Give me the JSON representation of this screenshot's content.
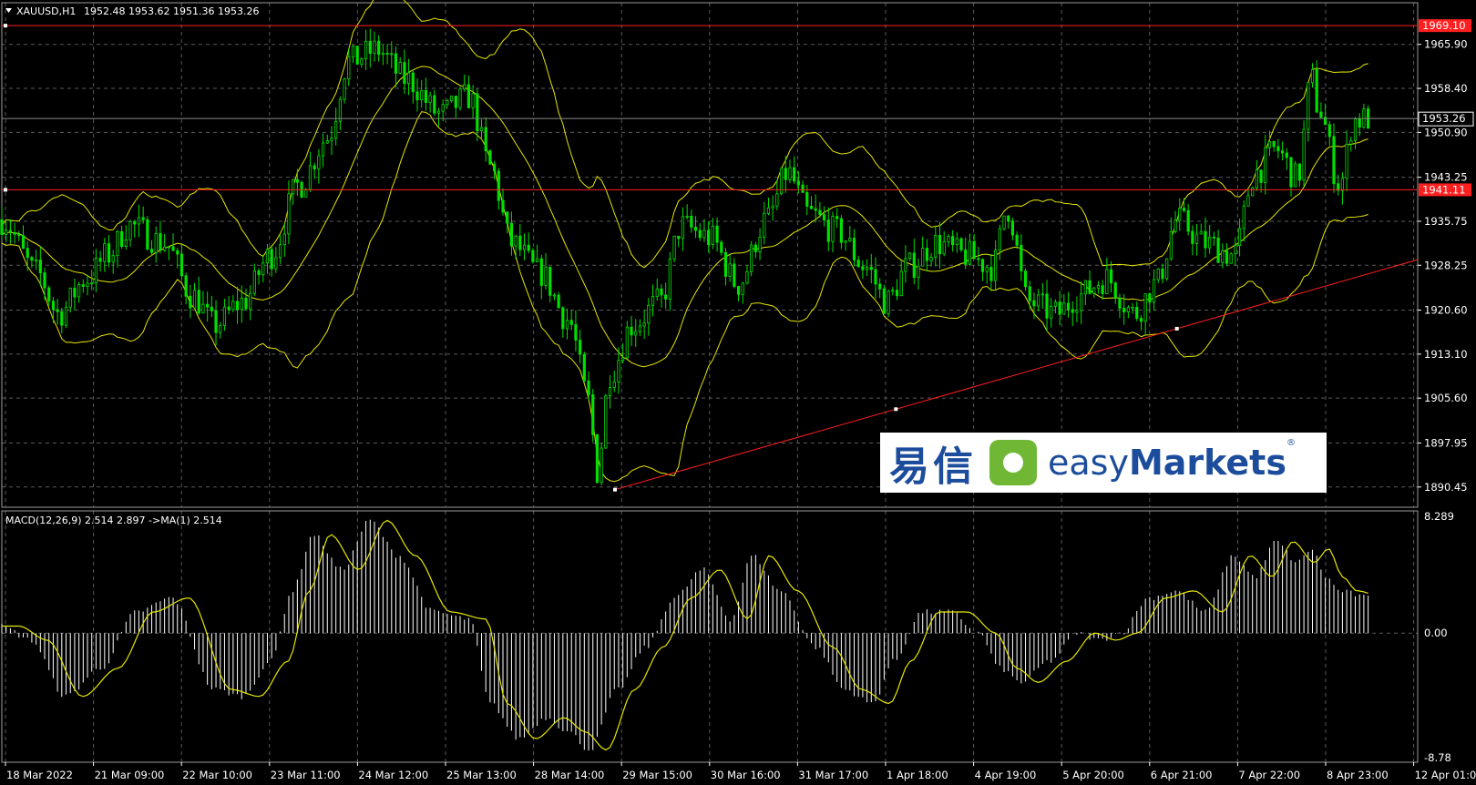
{
  "window": {
    "header_symbol": "XAUUSD,H1",
    "header_ohlc": "1952.48 1953.62 1951.36 1953.26",
    "macd_header": "MACD(12,26,9) 2.514 2.897  ->MA(1) 2.514"
  },
  "colors": {
    "background": "#000000",
    "grid": "#5a5a5a",
    "candle": "#00e000",
    "bands": "#e6e600",
    "levels": "#ff1f1f",
    "histogram": "#ffffff",
    "signal": "#e6e600"
  },
  "price_axis": {
    "ticks": [
      "1965.90",
      "1958.40",
      "1950.90",
      "1943.25",
      "1935.75",
      "1928.25",
      "1920.60",
      "1913.10",
      "1905.60",
      "1897.95",
      "1890.45"
    ],
    "current_price": "1953.26",
    "level_labels": [
      "1969.10",
      "1941.11"
    ]
  },
  "macd_axis": {
    "ticks": [
      "8.289",
      "0.00",
      "-8.78"
    ]
  },
  "time_axis": {
    "labels": [
      "18 Mar 2022",
      "21 Mar 09:00",
      "22 Mar 10:00",
      "23 Mar 11:00",
      "24 Mar 12:00",
      "25 Mar 13:00",
      "28 Mar 14:00",
      "29 Mar 15:00",
      "30 Mar 16:00",
      "31 Mar 17:00",
      "1 Apr 18:00",
      "4 Apr 19:00",
      "5 Apr 20:00",
      "6 Apr 21:00",
      "7 Apr 22:00",
      "8 Apr 23:00",
      "12 Apr 01:00"
    ]
  },
  "logo": {
    "chinese": "易信",
    "english_light": "easy",
    "english_bold": "Markets",
    "registered": "®"
  },
  "chart_data": {
    "type": "candlestick",
    "symbol": "XAUUSD",
    "timeframe": "H1",
    "ylim": [
      1887,
      1973
    ],
    "macd_ylim": [
      -8.78,
      8.289
    ],
    "horizontal_lines": [
      1969.1,
      1941.11
    ],
    "trendline": {
      "from": {
        "bar": 0.0,
        "price": 1890.0
      },
      "to": {
        "bar": 1.0,
        "price": 1929.2
      }
    },
    "price_anchors": [
      [
        0.0,
        1936
      ],
      [
        0.025,
        1927
      ],
      [
        0.04,
        1920
      ],
      [
        0.06,
        1926
      ],
      [
        0.075,
        1930
      ],
      [
        0.09,
        1935
      ],
      [
        0.115,
        1932
      ],
      [
        0.135,
        1923
      ],
      [
        0.15,
        1918
      ],
      [
        0.17,
        1922
      ],
      [
        0.19,
        1930
      ],
      [
        0.21,
        1942
      ],
      [
        0.23,
        1950
      ],
      [
        0.245,
        1963
      ],
      [
        0.265,
        1965
      ],
      [
        0.285,
        1960
      ],
      [
        0.31,
        1954
      ],
      [
        0.33,
        1957
      ],
      [
        0.345,
        1945
      ],
      [
        0.36,
        1932
      ],
      [
        0.38,
        1927
      ],
      [
        0.4,
        1919
      ],
      [
        0.415,
        1905
      ],
      [
        0.42,
        1893
      ],
      [
        0.43,
        1910
      ],
      [
        0.445,
        1918
      ],
      [
        0.465,
        1922
      ],
      [
        0.48,
        1935
      ],
      [
        0.5,
        1933
      ],
      [
        0.52,
        1925
      ],
      [
        0.54,
        1936
      ],
      [
        0.555,
        1944
      ],
      [
        0.57,
        1937
      ],
      [
        0.59,
        1934
      ],
      [
        0.61,
        1928
      ],
      [
        0.625,
        1922
      ],
      [
        0.64,
        1928
      ],
      [
        0.66,
        1932
      ],
      [
        0.68,
        1930
      ],
      [
        0.7,
        1928
      ],
      [
        0.71,
        1938
      ],
      [
        0.725,
        1922
      ],
      [
        0.745,
        1920
      ],
      [
        0.76,
        1923
      ],
      [
        0.78,
        1926
      ],
      [
        0.8,
        1920
      ],
      [
        0.815,
        1925
      ],
      [
        0.83,
        1936
      ],
      [
        0.85,
        1932
      ],
      [
        0.87,
        1930
      ],
      [
        0.885,
        1944
      ],
      [
        0.9,
        1948
      ],
      [
        0.915,
        1943
      ],
      [
        0.925,
        1960
      ],
      [
        0.93,
        1955
      ],
      [
        0.945,
        1942
      ],
      [
        0.955,
        1953
      ],
      [
        0.965,
        1953.26
      ]
    ],
    "macd_anchors": [
      [
        0.0,
        0.5
      ],
      [
        0.02,
        -0.5
      ],
      [
        0.045,
        -4.5
      ],
      [
        0.07,
        -2.5
      ],
      [
        0.095,
        1.5
      ],
      [
        0.12,
        2.5
      ],
      [
        0.15,
        -4.0
      ],
      [
        0.17,
        -4.5
      ],
      [
        0.19,
        -2.0
      ],
      [
        0.205,
        3.0
      ],
      [
        0.22,
        7.0
      ],
      [
        0.24,
        4.5
      ],
      [
        0.26,
        8.0
      ],
      [
        0.28,
        5.5
      ],
      [
        0.305,
        1.5
      ],
      [
        0.33,
        1.0
      ],
      [
        0.345,
        -5.0
      ],
      [
        0.365,
        -7.5
      ],
      [
        0.385,
        -6.0
      ],
      [
        0.4,
        -7.0
      ],
      [
        0.415,
        -8.3
      ],
      [
        0.435,
        -4.0
      ],
      [
        0.455,
        -1.0
      ],
      [
        0.475,
        2.5
      ],
      [
        0.495,
        4.5
      ],
      [
        0.515,
        1.0
      ],
      [
        0.53,
        5.5
      ],
      [
        0.55,
        3.0
      ],
      [
        0.575,
        -1.0
      ],
      [
        0.595,
        -4.0
      ],
      [
        0.615,
        -5.0
      ],
      [
        0.63,
        -2.0
      ],
      [
        0.65,
        1.5
      ],
      [
        0.67,
        1.5
      ],
      [
        0.69,
        0.0
      ],
      [
        0.705,
        -2.5
      ],
      [
        0.72,
        -3.5
      ],
      [
        0.74,
        -2.0
      ],
      [
        0.76,
        0.0
      ],
      [
        0.775,
        -0.5
      ],
      [
        0.79,
        0.0
      ],
      [
        0.81,
        2.5
      ],
      [
        0.83,
        3.0
      ],
      [
        0.85,
        1.5
      ],
      [
        0.87,
        5.5
      ],
      [
        0.885,
        4.0
      ],
      [
        0.9,
        6.5
      ],
      [
        0.915,
        5.0
      ],
      [
        0.925,
        6.0
      ],
      [
        0.935,
        4.0
      ],
      [
        0.945,
        3.0
      ],
      [
        0.965,
        2.514
      ]
    ]
  }
}
